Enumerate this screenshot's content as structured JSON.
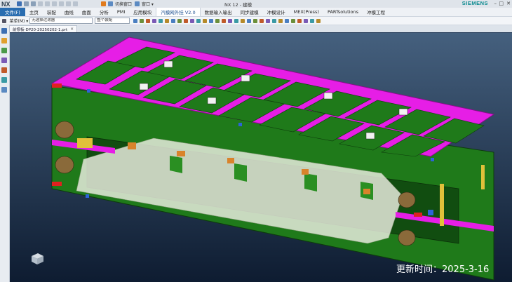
{
  "app": {
    "logo": "NX",
    "window_title": "NX 12 - 建模",
    "brand": "SIEMENS",
    "quick_access": {
      "switch_window_label": "切换窗口",
      "window_menu_label": "窗口 ▾"
    },
    "window_controls": {
      "minimize": "–",
      "maximize": "□",
      "close": "✕"
    }
  },
  "menu": {
    "file": "文件(F)",
    "items": [
      "主页",
      "装配",
      "曲线",
      "曲面",
      "分析",
      "PMI",
      "应用模块",
      "汽模网外挂 V2.0",
      "数据输入输出",
      "同步建模",
      "冲模设计",
      "MEX(Press)",
      "PARTsolutions",
      "冲模工程"
    ],
    "active_index": 7
  },
  "toolbar": {
    "menu_label": "菜单(M) ▾",
    "filter_value": "无选择过滤器",
    "assembly_value": "整个装配",
    "icons": [
      "select-icon",
      "snap-icon",
      "point-icon",
      "curve-icon",
      "face-icon",
      "body-icon",
      "edge-icon",
      "vertex-icon",
      "plane-icon",
      "axis-icon",
      "csys-icon",
      "mid-icon",
      "tangent-icon",
      "quadrant-icon",
      "intersection-icon",
      "center-icon",
      "measure-icon",
      "color-icon",
      "render-icon",
      "hide-icon",
      "show-icon",
      "layer-icon",
      "grid-icon",
      "view-icon",
      "fit-icon",
      "zoom-icon",
      "rotate-icon",
      "pan-icon",
      "section-icon",
      "wcs-icon"
    ]
  },
  "document_tab": {
    "label": "前撑板-DP20-20250202-1.prt",
    "close": "×"
  },
  "sidebar": {
    "icons": [
      "part-navigator-icon",
      "assembly-navigator-icon",
      "constraint-navigator-icon",
      "reuse-library-icon",
      "history-icon",
      "roles-icon",
      "web-browser-icon"
    ]
  },
  "viewport": {
    "background_top": "#45607e",
    "background_bottom": "#0e1c31"
  },
  "update_stamp": "更新时间：2025-3-16",
  "colors": {
    "menu_accent": "#2a6db0",
    "die_top": "#e61ee6",
    "die_body": "#1f7a1a",
    "die_body_dark": "#114d10",
    "section_glass": "#eef0e4",
    "brand": "#0b8a8f"
  }
}
